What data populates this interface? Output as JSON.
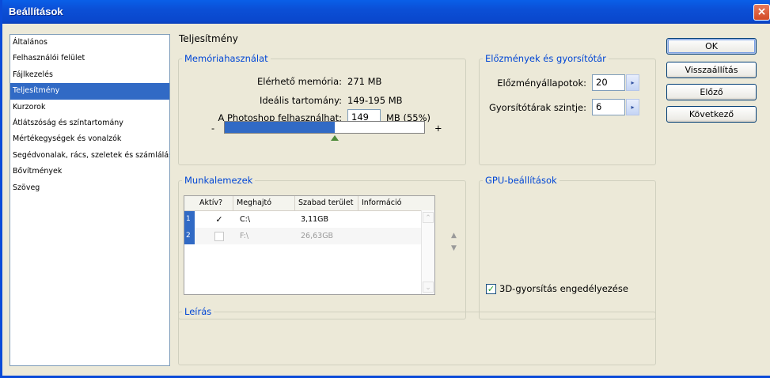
{
  "window": {
    "title": "Beállítások",
    "close_glyph": "×"
  },
  "sidebar": {
    "items": [
      {
        "label": "Általános"
      },
      {
        "label": "Felhasználói felület"
      },
      {
        "label": "Fájlkezelés"
      },
      {
        "label": "Teljesítmény",
        "selected": true
      },
      {
        "label": "Kurzorok"
      },
      {
        "label": "Átlátszóság és színtartomány"
      },
      {
        "label": "Mértékegységek és vonalzók"
      },
      {
        "label": "Segédvonalak, rács, szeletek és számlálás"
      },
      {
        "label": "Bővítmények"
      },
      {
        "label": "Szöveg"
      }
    ]
  },
  "page_title": "Teljesítmény",
  "memory": {
    "title": "Memóriahasználat",
    "available_label": "Elérhető memória:",
    "available_value": "271 MB",
    "ideal_label": "Ideális tartomány:",
    "ideal_value": "149-195 MB",
    "photoshop_label": "A Photoshop felhasználhat:",
    "photoshop_value": "149",
    "photoshop_suffix": "MB (55%)",
    "slider_minus": "-",
    "slider_plus": "+",
    "slider_fraction": 0.55
  },
  "history": {
    "title": "Előzmények és gyorsítótár",
    "states_label": "Előzményállapotok:",
    "states_value": "20",
    "cache_label": "Gyorsítótárak szintje:",
    "cache_value": "6"
  },
  "scratch": {
    "title": "Munkalemezek",
    "columns": [
      "Aktív?",
      "Meghajtó",
      "Szabad terület",
      "Információ"
    ],
    "rows": [
      {
        "num": "1",
        "active": true,
        "drive": "C:\\",
        "free": "3,11GB",
        "info": ""
      },
      {
        "num": "2",
        "active": false,
        "drive": "F:\\",
        "free": "26,63GB",
        "info": ""
      }
    ]
  },
  "gpu": {
    "title": "GPU-beállítások",
    "accel_label": "3D-gyorsítás engedélyezése",
    "accel_checked": true
  },
  "description": {
    "title": "Leírás"
  },
  "buttons": {
    "ok": "OK",
    "reset": "Visszaállítás",
    "prev": "Előző",
    "next": "Következő"
  },
  "icons": {
    "spin_right": "▸",
    "move_up": "▲",
    "move_down": "▼",
    "scroll_up": "⌃",
    "scroll_down": "⌄",
    "check": "✓"
  }
}
